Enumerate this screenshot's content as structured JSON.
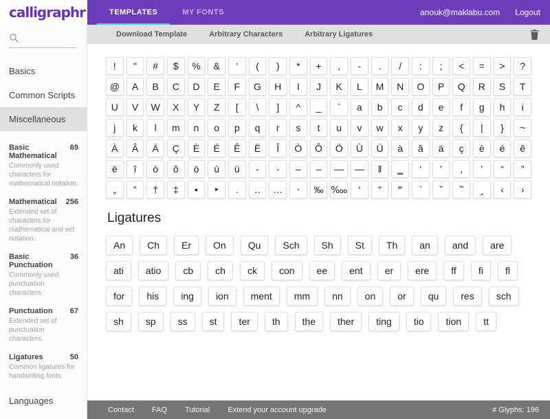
{
  "header": {
    "logo": "calligraphr",
    "tabs": [
      {
        "label": "TEMPLATES",
        "active": true
      },
      {
        "label": "MY FONTS",
        "active": false
      }
    ],
    "email": "anouk@maklabu.com",
    "logout_label": "Logout"
  },
  "toolbar": {
    "buttons": [
      "Download Template",
      "Arbitrary Characters",
      "Arbitrary Ligatures"
    ]
  },
  "sidebar": {
    "search_placeholder": "",
    "sections": {
      "basics": "Basics",
      "common_scripts": "Common Scripts",
      "miscellaneous": "Miscellaneous",
      "languages": "Languages"
    },
    "misc_items": [
      {
        "name": "Basic Mathematical",
        "count": "69",
        "desc": "Commonly used characters for mathematical notation."
      },
      {
        "name": "Mathematical",
        "count": "256",
        "desc": "Extended set of characters for mathematical and set notation."
      },
      {
        "name": "Basic Punctuation",
        "count": "36",
        "desc": "Commonly used punctuation characters."
      },
      {
        "name": "Punctuation",
        "count": "67",
        "desc": "Extended set of punctuation characters."
      },
      {
        "name": "Ligatures",
        "count": "50",
        "desc": "Common ligatures for handwriting fonts."
      }
    ]
  },
  "glyphs": {
    "rows": [
      [
        "!",
        "\"",
        "#",
        "$",
        "%",
        "&",
        "'",
        "(",
        ")",
        "*",
        "+",
        ",",
        "-",
        ".",
        "/",
        ":",
        ";",
        "<",
        "=",
        ">",
        "?"
      ],
      [
        "@",
        "A",
        "B",
        "C",
        "D",
        "E",
        "F",
        "G",
        "H",
        "I",
        "J",
        "K",
        "L",
        "M",
        "N",
        "O",
        "P",
        "Q",
        "R",
        "S",
        "T"
      ],
      [
        "U",
        "V",
        "W",
        "X",
        "Y",
        "Z",
        "[",
        "\\",
        "]",
        "^",
        "_",
        "`",
        "a",
        "b",
        "c",
        "d",
        "e",
        "f",
        "g",
        "h",
        "i"
      ],
      [
        "j",
        "k",
        "l",
        "m",
        "n",
        "o",
        "p",
        "q",
        "r",
        "s",
        "t",
        "u",
        "v",
        "w",
        "x",
        "y",
        "z",
        "{",
        "|",
        "}",
        "~"
      ],
      [
        "À",
        "Â",
        "Ä",
        "Ç",
        "È",
        "É",
        "Ê",
        "Ë",
        "Î",
        "Ò",
        "Ô",
        "Ö",
        "Ù",
        "Ü",
        "à",
        "â",
        "ä",
        "ç",
        "è",
        "é",
        "ê"
      ],
      [
        "ë",
        "î",
        "ò",
        "ô",
        "ö",
        "ù",
        "ü",
        "‐",
        "‑",
        "‒",
        "–",
        "—",
        "―",
        "‖",
        "‗",
        "‘",
        "’",
        "‚",
        "‛",
        "“",
        "”"
      ],
      [
        "„",
        "‟",
        "†",
        "‡",
        "•",
        "‣",
        "․",
        "‥",
        "…",
        "‧",
        "‰",
        "‱",
        "′",
        "″",
        "‴",
        "‵",
        "‶",
        "‷",
        "‸",
        "‹",
        "›"
      ]
    ]
  },
  "ligatures": {
    "heading": "Ligatures",
    "items": [
      "An",
      "Ch",
      "Er",
      "On",
      "Qu",
      "Sch",
      "Sh",
      "St",
      "Th",
      "an",
      "and",
      "are",
      "ati",
      "atio",
      "cb",
      "ch",
      "ck",
      "con",
      "ee",
      "ent",
      "er",
      "ere",
      "ff",
      "fi",
      "fl",
      "for",
      "his",
      "ing",
      "ion",
      "ment",
      "mm",
      "nn",
      "on",
      "or",
      "qu",
      "res",
      "sch",
      "sh",
      "sp",
      "ss",
      "st",
      "ter",
      "th",
      "the",
      "ther",
      "ting",
      "tio",
      "tion",
      "tt"
    ]
  },
  "footer": {
    "links": [
      "Contact",
      "FAQ",
      "Tutorial",
      "Extend your account upgrade"
    ],
    "glyph_count": "# Glyphs: 196"
  },
  "colors": {
    "header_purple": "#6d3cba",
    "logo_purple": "#6633b9",
    "active_tab_underline": "#4dd0e1",
    "toolbar_gray": "#e0e0e0",
    "footer_gray": "#757575",
    "selected_nav_gray": "#e0e0e0"
  }
}
